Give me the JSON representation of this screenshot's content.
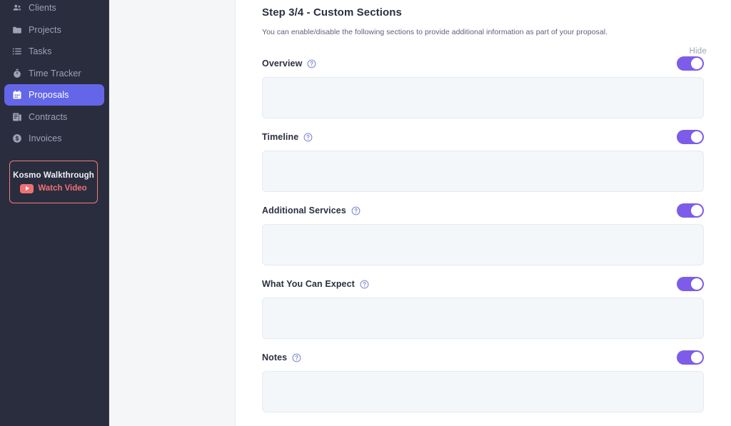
{
  "sidebar": {
    "nav_items": [
      {
        "label": "Clients",
        "icon": "people-icon",
        "active": false
      },
      {
        "label": "Projects",
        "icon": "folder-icon",
        "active": false
      },
      {
        "label": "Tasks",
        "icon": "list-icon",
        "active": false
      },
      {
        "label": "Time Tracker",
        "icon": "stopwatch-icon",
        "active": false
      },
      {
        "label": "Proposals",
        "icon": "calendar-icon",
        "active": true
      },
      {
        "label": "Contracts",
        "icon": "document-icon",
        "active": false
      },
      {
        "label": "Invoices",
        "icon": "dollar-circle-icon",
        "active": false
      }
    ],
    "walkthrough": {
      "title": "Kosmo Walkthrough",
      "link_label": "Watch Video",
      "play_icon": "play-icon",
      "border_color": "#ef7e7e",
      "accent_color": "#ef7272"
    },
    "background_color": "#2a2d3e",
    "active_color": "#6366e8"
  },
  "main": {
    "title": "Step 3/4 - Custom Sections",
    "subtitle": "You can enable/disable the following sections to provide additional information as part of your proposal.",
    "hide_column_label": "Hide",
    "toggle_on_color": "#7c5ce8",
    "help_icon_name": "help-circle-icon",
    "sections": [
      {
        "label": "Overview",
        "help_icon": "help-circle-icon",
        "enabled": true,
        "value": "",
        "placeholder": ""
      },
      {
        "label": "Timeline",
        "help_icon": "help-circle-icon",
        "enabled": true,
        "value": "",
        "placeholder": ""
      },
      {
        "label": "Additional Services",
        "help_icon": "help-circle-icon",
        "enabled": true,
        "value": "",
        "placeholder": ""
      },
      {
        "label": "What You Can Expect",
        "help_icon": "help-circle-icon",
        "enabled": true,
        "value": "",
        "placeholder": ""
      },
      {
        "label": "Notes",
        "help_icon": "help-circle-icon",
        "enabled": true,
        "value": "",
        "placeholder": ""
      }
    ]
  }
}
